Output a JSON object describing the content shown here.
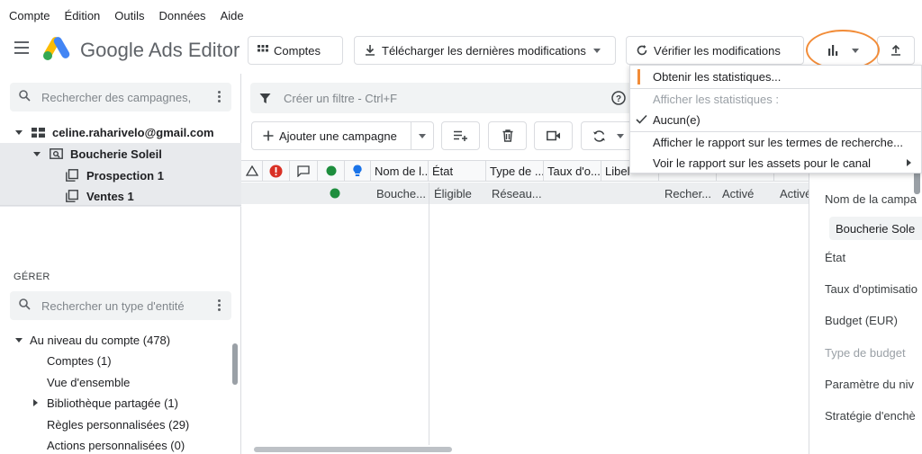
{
  "menu": [
    "Compte",
    "Édition",
    "Outils",
    "Données",
    "Aide"
  ],
  "brand": "Google Ads Editor",
  "toolbar": {
    "accounts_label": "Comptes",
    "download_label": "Télécharger les dernières modifications",
    "verify_label": "Vérifier les modifications"
  },
  "left": {
    "search_placeholder": "Rechercher des campagnes, ...",
    "account": "celine.raharivelo@gmail.com",
    "campaign": "Boucherie Soleil",
    "adgroups": [
      "Prospection 1",
      "Ventes 1"
    ],
    "manage_title": "GÉRER",
    "entity_search_placeholder": "Rechercher un type d'entité",
    "account_level": "Au niveau du compte (478)",
    "entities": [
      "Comptes (1)",
      "Vue d'ensemble",
      "Bibliothèque partagée (1)",
      "Règles personnalisées (29)",
      "Actions personnalisées (0)"
    ]
  },
  "main": {
    "filter_placeholder": "Créer un filtre - Ctrl+F",
    "add_campaign_label": "Ajouter une campagne",
    "columns": [
      "Nom de l...",
      "État",
      "Type de ...",
      "Taux d'o...",
      "Libel"
    ],
    "row": {
      "name": "Bouche...",
      "status": "Éligible",
      "type": "Réseau...",
      "col8": "Recher...",
      "col9": "Activé",
      "col10": "Activé"
    }
  },
  "dropdown": {
    "get_stats": "Obtenir les statistiques...",
    "show_stats_header": "Afficher les statistiques :",
    "none_label": "Aucun(e)",
    "search_terms_report": "Afficher le rapport sur les termes de recherche...",
    "assets_report": "Voir le rapport sur les assets pour le canal"
  },
  "right": {
    "campaign_name_label": "Nom de la campa",
    "campaign_name_value": "Boucherie Sole",
    "status_label": "État",
    "opt_score_label": "Taux d'optimisatio",
    "budget_label": "Budget (EUR)",
    "budget_type_label": "Type de budget",
    "param_label": "Paramètre du niv",
    "bid_strategy_label": "Stratégie d'enchè"
  },
  "colors": {
    "accent_orange": "#f28c38",
    "status_green": "#1e8e3e",
    "error_red": "#d93025",
    "bulb_blue": "#1a73e8"
  }
}
